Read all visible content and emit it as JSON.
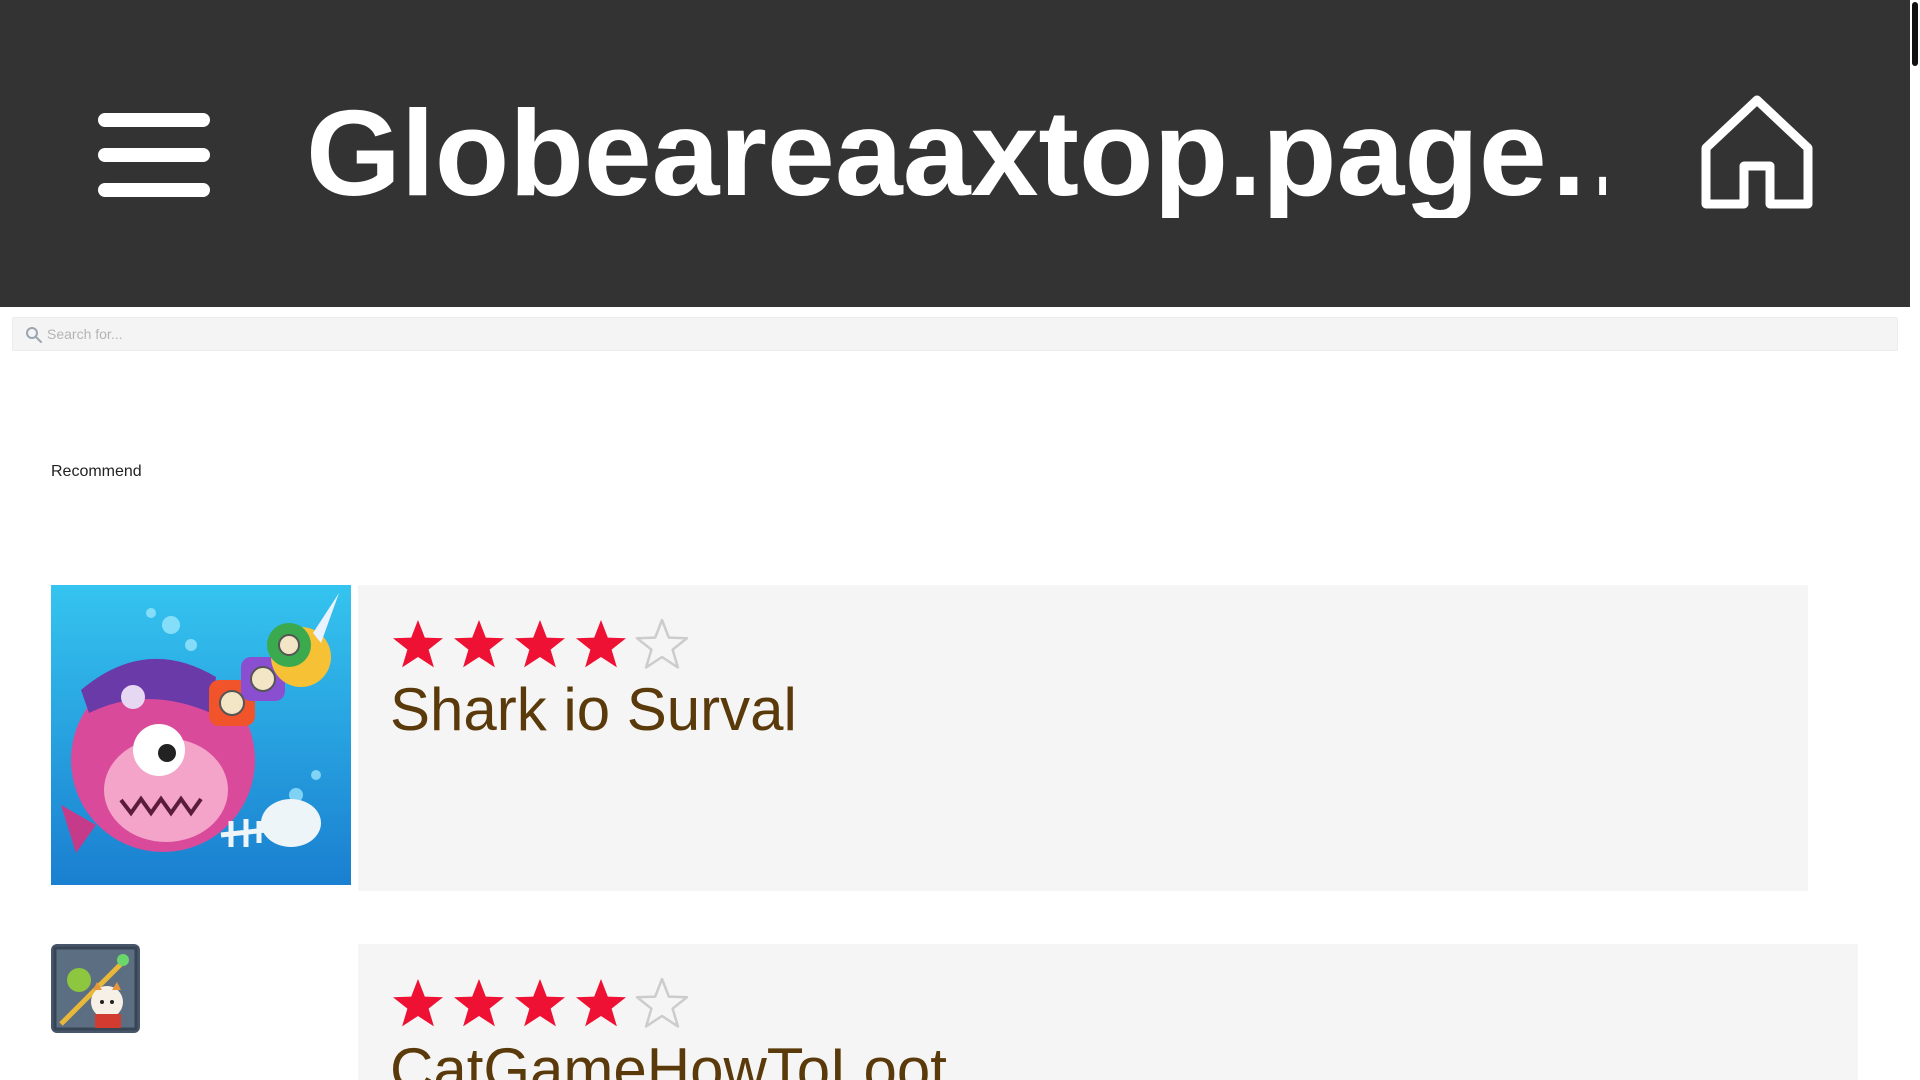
{
  "header": {
    "site_title": "Globeareaaxtop.page…",
    "menu_icon": "hamburger-menu-icon",
    "home_icon": "home-icon",
    "background_color": "#333333"
  },
  "search": {
    "placeholder": "Search for...",
    "value": "",
    "icon": "search-icon"
  },
  "section": {
    "heading": "Recommend"
  },
  "games": [
    {
      "name": "Shark io Surval",
      "rating": 4,
      "max_rating": 5,
      "thumbnail": "pirate-shark-game-thumbnail"
    },
    {
      "name": "CatGameHowToLoot",
      "rating": 4,
      "max_rating": 5,
      "thumbnail": "cat-loot-game-thumbnail"
    }
  ],
  "colors": {
    "star_filled": "#ee1133",
    "star_empty": "#cccccc",
    "game_name": "#5a3a0a",
    "card_background": "#f5f5f5"
  }
}
